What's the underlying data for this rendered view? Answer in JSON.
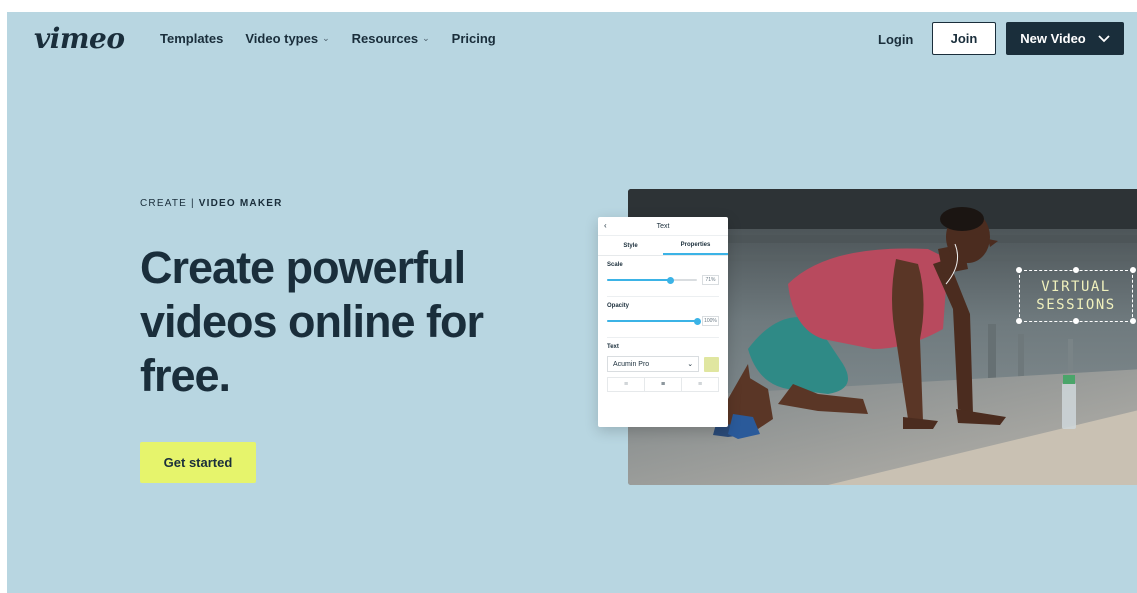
{
  "header": {
    "logo": "vimeo",
    "nav": [
      {
        "label": "Templates",
        "has_dropdown": false
      },
      {
        "label": "Video types",
        "has_dropdown": true
      },
      {
        "label": "Resources",
        "has_dropdown": true
      },
      {
        "label": "Pricing",
        "has_dropdown": false
      }
    ],
    "login_label": "Login",
    "join_label": "Join",
    "new_video_label": "New Video"
  },
  "hero": {
    "eyebrow_prefix": "CREATE | ",
    "eyebrow_bold": "VIDEO MAKER",
    "headline": "Create powerful videos online for free.",
    "cta_label": "Get started"
  },
  "editor_panel": {
    "title": "Text",
    "tabs": [
      "Style",
      "Properties"
    ],
    "active_tab": "Properties",
    "scale_label": "Scale",
    "scale_value": "71%",
    "scale_fraction": 0.71,
    "opacity_label": "Opacity",
    "opacity_value": "100%",
    "opacity_fraction": 1.0,
    "text_label": "Text",
    "font_value": "Acumin Pro",
    "swatch_color": "#e0e6a0",
    "alignments": [
      "left",
      "center",
      "right"
    ],
    "active_alignment": "center"
  },
  "overlay_text": {
    "line1": "VIRTUAL",
    "line2": "SESSIONS"
  },
  "colors": {
    "page_bg": "#b8d6e1",
    "primary": "#1a2e3b",
    "cta": "#e6f46c",
    "accent": "#3bb3e6"
  }
}
